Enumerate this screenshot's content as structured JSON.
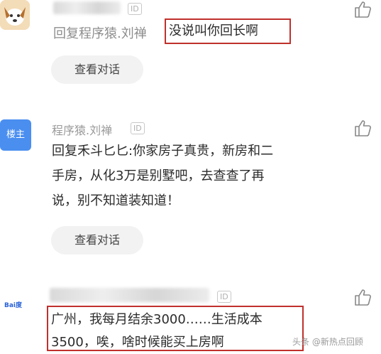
{
  "comment1": {
    "reply_prefix": "回复程序猿.刘禅",
    "highlight": "没说叫你回长啊",
    "id_badge": "ID",
    "view_button": "查看对话"
  },
  "comment2": {
    "owner_badge": "楼主",
    "username": "程序猿.刘禅",
    "id_badge": "ID",
    "line1": "回复禾斗匕匕:你家房子真贵，新房和二",
    "line2": "手房，从化3万是别墅吧，去查查了再",
    "line3": "说，别不知道装知道！",
    "view_button": "查看对话"
  },
  "comment3": {
    "logo_text": "Bai度",
    "id_badge": "ID",
    "line1": "广州，我每月结余3000……生活成本",
    "line2": "3500，唉，啥时候能买上房啊"
  },
  "watermark": "头条 @新热点回顾"
}
